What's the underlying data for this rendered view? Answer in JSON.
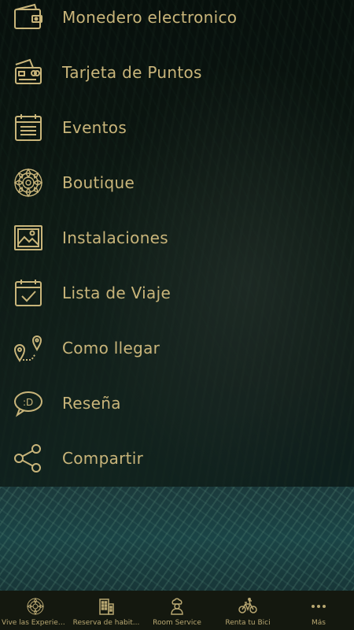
{
  "colors": {
    "accent": "#c9b57a",
    "tabbar_bg": "#14180f"
  },
  "menu": {
    "items": [
      {
        "label": "Monedero electronico",
        "icon": "wallet-icon"
      },
      {
        "label": "Tarjeta de Puntos",
        "icon": "points-card-icon"
      },
      {
        "label": "Eventos",
        "icon": "calendar-list-icon"
      },
      {
        "label": "Boutique",
        "icon": "mandala-icon"
      },
      {
        "label": "Instalaciones",
        "icon": "image-icon"
      },
      {
        "label": "Lista de Viaje",
        "icon": "calendar-check-icon"
      },
      {
        "label": "Como llegar",
        "icon": "route-pin-icon"
      },
      {
        "label": "Reseña",
        "icon": "chat-smile-icon"
      },
      {
        "label": "Compartir",
        "icon": "share-icon"
      }
    ]
  },
  "tabbar": {
    "tabs": [
      {
        "label": "Vive las Experien...",
        "icon": "mandala-icon"
      },
      {
        "label": "Reserva de habit...",
        "icon": "building-icon"
      },
      {
        "label": "Room Service",
        "icon": "chef-icon"
      },
      {
        "label": "Renta tu Bici",
        "icon": "bicycle-icon"
      },
      {
        "label": "Más",
        "icon": "more-icon"
      }
    ]
  }
}
